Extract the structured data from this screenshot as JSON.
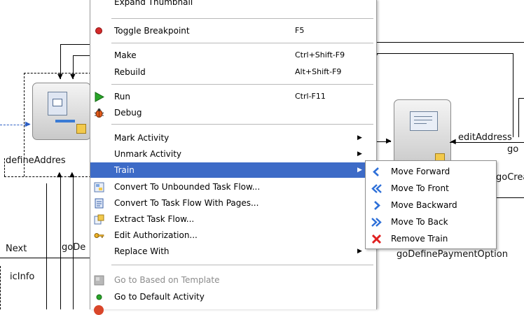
{
  "diagram": {
    "nodes": {
      "define_address": {
        "label": "defineAddres"
      },
      "right_activity": {
        "label": ""
      }
    },
    "labels": {
      "edit_address": "editAddress",
      "go_top": "go",
      "go_crea": "goCrea",
      "go_define_payment": "goDefinePaymentOption",
      "next": "Next",
      "go_de": "goDe",
      "ic_info": "icInfo"
    }
  },
  "context_menu": {
    "top_partial": "Expand Thumbnail",
    "items": [
      {
        "label": "Toggle Breakpoint",
        "shortcut": "F5",
        "icon": "breakpoint-dot-icon"
      },
      {
        "label": "Make",
        "shortcut": "Ctrl+Shift-F9"
      },
      {
        "label": "Rebuild",
        "shortcut": "Alt+Shift-F9"
      },
      {
        "label": "Run",
        "shortcut": "Ctrl-F11",
        "icon": "run-icon"
      },
      {
        "label": "Debug",
        "shortcut": "",
        "icon": "debug-bug-icon"
      },
      {
        "label": "Mark Activity",
        "submenu": true
      },
      {
        "label": "Unmark Activity",
        "submenu": true
      },
      {
        "label": "Train",
        "submenu": true,
        "selected": true
      },
      {
        "label": "Convert To Unbounded Task Flow...",
        "icon": "convert-unbounded-icon"
      },
      {
        "label": "Convert To Task Flow With Pages...",
        "icon": "convert-pages-icon"
      },
      {
        "label": "Extract Task Flow...",
        "icon": "extract-task-flow-icon"
      },
      {
        "label": "Edit Authorization...",
        "icon": "key-icon"
      },
      {
        "label": "Replace With",
        "submenu": true
      },
      {
        "label": "Go to Based on Template",
        "disabled": true,
        "icon": "template-icon"
      },
      {
        "label": "Go to Default Activity",
        "icon": "default-activity-icon"
      }
    ]
  },
  "train_submenu": {
    "items": [
      {
        "label": "Move Forward",
        "icon": "move-forward-icon"
      },
      {
        "label": "Move To Front",
        "icon": "move-to-front-icon"
      },
      {
        "label": "Move Backward",
        "icon": "move-backward-icon"
      },
      {
        "label": "Move To Back",
        "icon": "move-to-back-icon"
      },
      {
        "label": "Remove Train",
        "icon": "remove-train-icon"
      }
    ]
  },
  "colors": {
    "selection": "#3d6bc7",
    "remove_icon": "#e02020",
    "arrow_icon": "#2d6fd8",
    "run_icon": "#2aa52a",
    "breakpoint": "#d42a2a"
  }
}
